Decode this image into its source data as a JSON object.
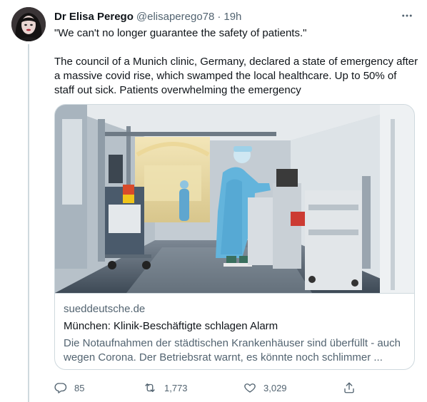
{
  "tweet": {
    "author": {
      "name": "Dr Elisa Perego",
      "handle": "@elisaperego78",
      "separator": "·",
      "time": "19h"
    },
    "text": {
      "line1": "\"We can't no longer guarantee the safety of patients.\"",
      "line2": "The council of a Munich clinic, Germany, declared a state of emergency after a massive covid rise, which swamped the local healthcare. Up to 50% of staff out sick. Patients overwhelming the emergency"
    },
    "card": {
      "domain": "sueddeutsche.de",
      "title": "München: Klinik-Beschäftigte schlagen Alarm",
      "description": "Die Notaufnahmen der städtischen Krankenhäuser sind überfüllt - auch wegen Corona. Der Betriebsrat warnt, es könnte noch schlimmer ..."
    },
    "actions": {
      "reply_count": "85",
      "retweet_count": "1,773",
      "like_count": "3,029"
    }
  },
  "icons": {
    "more": "more-horizontal-icon",
    "reply": "reply-icon",
    "retweet": "retweet-icon",
    "like": "heart-icon",
    "share": "share-icon"
  },
  "colors": {
    "text_primary": "#0f1419",
    "text_secondary": "#536471",
    "border": "#cfd9de"
  }
}
